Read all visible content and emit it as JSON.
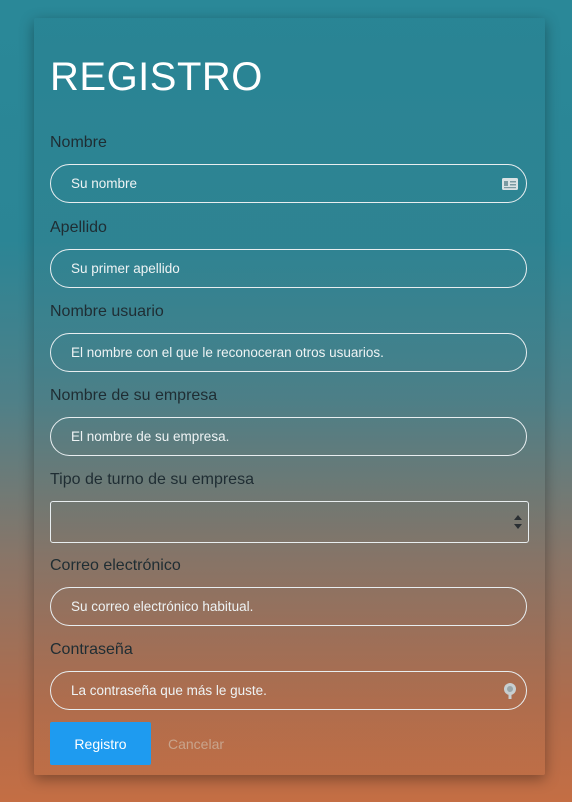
{
  "form": {
    "title": "REGISTRO",
    "fields": [
      {
        "label": "Nombre",
        "placeholder": "Su nombre",
        "icon": "id-card-icon"
      },
      {
        "label": "Apellido",
        "placeholder": "Su primer apellido"
      },
      {
        "label": "Nombre usuario",
        "placeholder": "El nombre con el que le reconoceran otros usuarios."
      },
      {
        "label": "Nombre de su empresa",
        "placeholder": "El nombre de su empresa."
      },
      {
        "label": "Tipo de turno de su empresa",
        "value": ""
      },
      {
        "label": "Correo electrónico",
        "placeholder": "Su correo electrónico habitual."
      },
      {
        "label": "Contraseña",
        "placeholder": "La contraseña que más le guste.",
        "icon": "key-icon"
      }
    ],
    "submit_label": "Registro",
    "cancel_label": "Cancelar"
  },
  "colors": {
    "primary_button": "#1e9bf0",
    "gradient_top": "#2a8898",
    "gradient_bottom": "#c46e44"
  }
}
